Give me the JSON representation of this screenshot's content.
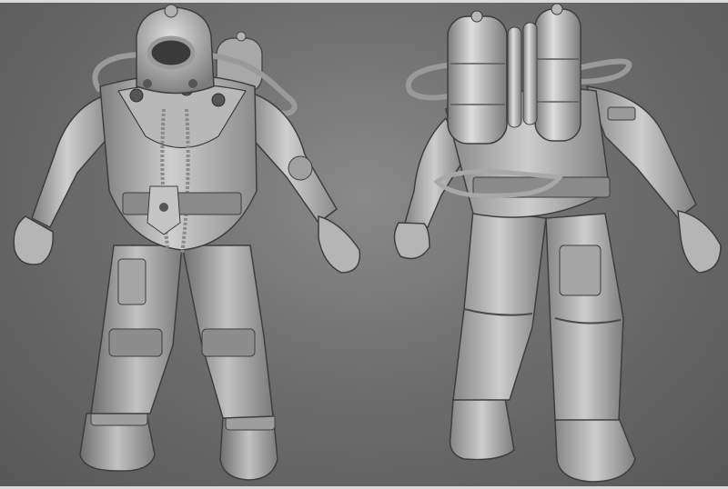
{
  "image": {
    "subject": "",
    "views": [
      {
        "name": "front-view",
        "label": ""
      },
      {
        "name": "back-view",
        "label": ""
      }
    ],
    "colors": {
      "background": "#6e6e6e",
      "model_light": "#c9c9c9",
      "model_mid": "#9a9a9a",
      "model_dark": "#3e3e3e",
      "frame": "#d9d9d9"
    }
  }
}
